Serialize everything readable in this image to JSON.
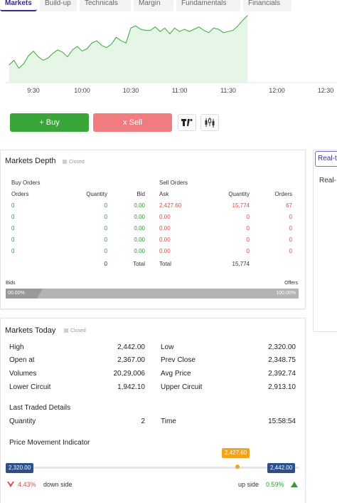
{
  "tabs": [
    "Markets",
    "Build-up",
    "Technicals",
    "Margin",
    "Fundamentals",
    "Financials"
  ],
  "active_tab": "Markets",
  "chart_data": {
    "type": "area",
    "x_ticks": [
      "9:30",
      "10:00",
      "10:30",
      "11:00",
      "11:30",
      "12:00",
      "12:30"
    ],
    "series": [
      {
        "x": [
          "9:15",
          "9:18",
          "9:21",
          "9:24",
          "9:27",
          "9:30",
          "9:33",
          "9:36",
          "9:39",
          "9:42",
          "9:45",
          "9:48",
          "9:51",
          "9:54",
          "9:57",
          "10:00",
          "10:03",
          "10:06",
          "10:09",
          "10:12",
          "10:15",
          "10:18",
          "10:21",
          "10:24",
          "10:27",
          "10:30",
          "10:33",
          "10:36",
          "10:39",
          "10:42",
          "10:45",
          "10:48",
          "10:51",
          "10:54",
          "10:57",
          "11:00",
          "11:03",
          "11:06",
          "11:09",
          "11:12",
          "11:15",
          "11:18",
          "11:21",
          "11:24",
          "11:27",
          "11:30",
          "11:33",
          "11:36",
          "11:39",
          "11:42"
        ],
        "values": [
          2370,
          2374,
          2367,
          2371,
          2378,
          2382,
          2377,
          2374,
          2376,
          2380,
          2383,
          2381,
          2377,
          2383,
          2386,
          2382,
          2384,
          2389,
          2391,
          2387,
          2385,
          2388,
          2394,
          2391,
          2389,
          2402,
          2404,
          2401,
          2400,
          2400,
          2403,
          2399,
          2402,
          2397,
          2402,
          2399,
          2401,
          2399,
          2401,
          2403,
          2400,
          2398,
          2402,
          2401,
          2398,
          2399,
          2400,
          2404,
          2409,
          2413
        ]
      }
    ],
    "fill_color": "#e6f6e6",
    "line_color": "#3aa63a"
  },
  "buttons": {
    "buy": "+ Buy",
    "sell": "x Sell"
  },
  "depth": {
    "title": "Markets Depth",
    "status": "Closed",
    "buy_header": "Buy Orders",
    "sell_header": "Sell Orders",
    "columns": [
      "Orders",
      "Quantity",
      "Bid",
      "Ask",
      "Quantity",
      "Orders"
    ],
    "rows": [
      [
        "0",
        "0",
        "0.00",
        "2,427.60",
        "15,774",
        "67"
      ],
      [
        "0",
        "0",
        "0.00",
        "0.00",
        "0",
        "0"
      ],
      [
        "0",
        "0",
        "0.00",
        "0.00",
        "0",
        "0"
      ],
      [
        "0",
        "0",
        "0.00",
        "0.00",
        "0",
        "0"
      ],
      [
        "0",
        "0",
        "0.00",
        "0.00",
        "0",
        "0"
      ]
    ],
    "total_buy_qty": "0",
    "total_label": "Total",
    "total_sell_qty": "15,774",
    "bids_label": "Bids",
    "offers_label": "Offers",
    "bids_pct": "00.00%",
    "offers_pct": "100.00%"
  },
  "today": {
    "title": "Markets Today",
    "status": "Closed",
    "high_label": "High",
    "high": "2,442.00",
    "low_label": "Low",
    "low": "2,320.00",
    "open_label": "Open at",
    "open": "2,367.00",
    "prev_label": "Prev Close",
    "prev": "2,348.75",
    "vol_label": "Volumes",
    "vol": "20,29,006",
    "avg_label": "Avg Price",
    "avg": "2,392.74",
    "lc_label": "Lower Circuit",
    "lc": "1,942.10",
    "uc_label": "Upper Circuit",
    "uc": "2,913.10",
    "ltd_label": "Last Traded Details",
    "qty_label": "Quantity",
    "qty": "2",
    "time_label": "Time",
    "time": "15:58:54",
    "pmi_label": "Price Movement Indicator",
    "pmi_low": "2,320.00",
    "pmi_high": "2,442.00",
    "pmi_ltp": "2,427.60",
    "pmi_fraction": 0.88,
    "down_pct": "4.43%",
    "down_label": "down side",
    "up_label": "up side",
    "up_pct": "0.59%"
  },
  "side": {
    "tab_label": "Real-t",
    "heading": "Real-"
  }
}
